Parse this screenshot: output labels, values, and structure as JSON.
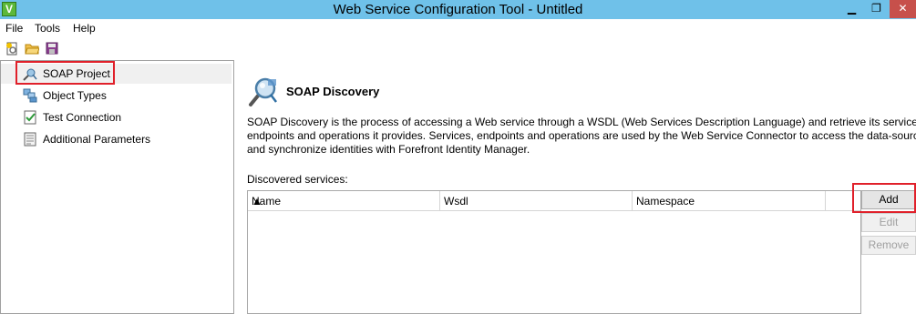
{
  "window": {
    "title": "Web Service Configuration Tool - Untitled",
    "app_icon_glyph": "V",
    "minimize_glyph": "▁",
    "maximize_glyph": "❐",
    "close_glyph": "✕"
  },
  "menu": {
    "items": [
      "File",
      "Tools",
      "Help"
    ]
  },
  "toolbar": {
    "icons": [
      "new-project-icon",
      "open-folder-icon",
      "save-icon"
    ]
  },
  "tree": {
    "items": [
      {
        "label": "SOAP Project",
        "icon": "soap-project-icon",
        "selected": true
      },
      {
        "label": "Object Types",
        "icon": "object-types-icon",
        "selected": false
      },
      {
        "label": "Test Connection",
        "icon": "test-connection-icon",
        "selected": false
      },
      {
        "label": "Additional Parameters",
        "icon": "additional-parameters-icon",
        "selected": false
      }
    ]
  },
  "main": {
    "section_title": "SOAP Discovery",
    "description": [
      "SOAP Discovery is the process of accessing a Web service through a WSDL (Web Services Description Language) and retrieve its services,",
      "endpoints and operations it provides. Services, endpoints and operations are used by the Web Service Connector to access the data-source",
      "and synchronize identities with Forefront Identity Manager."
    ],
    "discovered_label": "Discovered services:",
    "columns": [
      "Name",
      "Wsdl",
      "Namespace"
    ],
    "sort_indicator": "▲",
    "rows": []
  },
  "buttons": {
    "add": "Add",
    "edit": "Edit",
    "remove": "Remove"
  },
  "colors": {
    "titlebar": "#6fc1e9",
    "close_button": "#c7504b",
    "highlight": "#e0202a"
  }
}
